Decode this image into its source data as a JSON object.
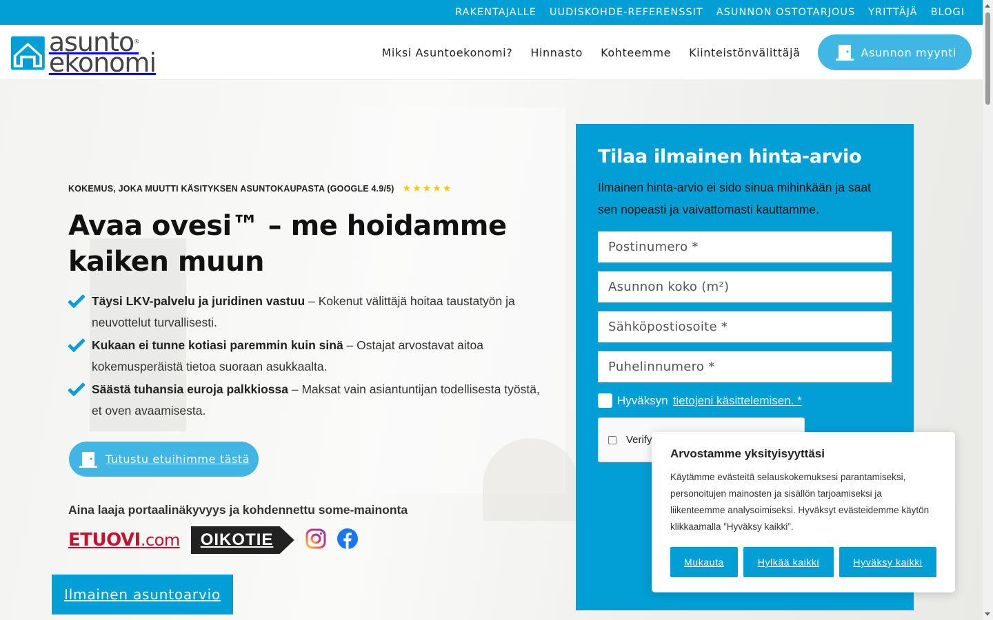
{
  "topbar": {
    "links": [
      "RAKENTAJALLE",
      "UUDISKOHDE-REFERENSSIT",
      "ASUNNON OSTOTARJOUS",
      "YRITTÄJÄ",
      "BLOGI"
    ]
  },
  "logo": {
    "line1": "asunto",
    "line2": "ekonomi",
    "registered": "®"
  },
  "nav": {
    "items": [
      "Miksi Asuntoekonomi?",
      "Hinnasto",
      "Kohteemme",
      "Kiinteistönvälittäjä"
    ],
    "cta": "Asunnon myynti"
  },
  "hero": {
    "reviews": "KOKEMUS, JOKA MUUTTI KÄSITYKSEN ASUNTOKAUPASTA (GOOGLE 4.9/5)",
    "stars": "★★★★★",
    "headline": "Avaa ovesi™ – me hoidamme kaiken muun",
    "benefits": [
      {
        "bold": "Täysi LKV-palvelu ja juridinen vastuu",
        "text": " – Kokenut välittäjä hoitaa taustatyön ja neuvottelut turvallisesti."
      },
      {
        "bold": "Kukaan ei tunne kotiasi paremmin kuin sinä",
        "text": " – Ostajat arvostavat aitoa kokemusperäistä tietoa suoraan asukkaalta."
      },
      {
        "bold": "Säästä tuhansia euroja palkkiossa",
        "text": " – Maksat vain asiantuntijan todellisesta työstä, et oven avaamisesta."
      }
    ],
    "benefits_button": "Tutustu etuihimme tästä",
    "portals_title": "Aina laaja portaalinäkyvyys ja kohdennettu some-mainonta",
    "portal_etuovi": "ETUOVI",
    "portal_etuovi_suffix": ".com",
    "portal_oikotie": "OIKOTIE",
    "free_button": "Ilmainen asuntoarvio"
  },
  "form": {
    "title": "Tilaa ilmainen hinta-arvio",
    "description": "Ilmainen hinta-arvio ei sido sinua mihinkään ja saat sen nopeasti ja vaivattomasti kauttamme.",
    "placeholders": {
      "postal": "Postinumero *",
      "size": "Asunnon koko (m²)",
      "email": "Sähköpostiosoite *",
      "phone": "Puhelinnumero *"
    },
    "consent_accept": "Hyväksyn",
    "consent_link": "tietojeni käsittelemisen. *",
    "verify": "Verify"
  },
  "cookie": {
    "title": "Arvostamme yksityisyyttäsi",
    "text": "Käytämme evästeitä selauskokemuksesi parantamiseksi, personoitujen mainosten ja sisällön tarjoamiseksi ja liikenteemme analysoimiseksi. Hyväksyt evästeidemme käytön klikkaamalla ”Hyväksy kaikki”.",
    "customize": "Mukauta",
    "reject": "Hylkää kaikki",
    "accept": "Hyväksy kaikki"
  },
  "colors": {
    "brand": "#019fd6",
    "button_light": "#3fb6e4",
    "star": "#f5c518"
  }
}
